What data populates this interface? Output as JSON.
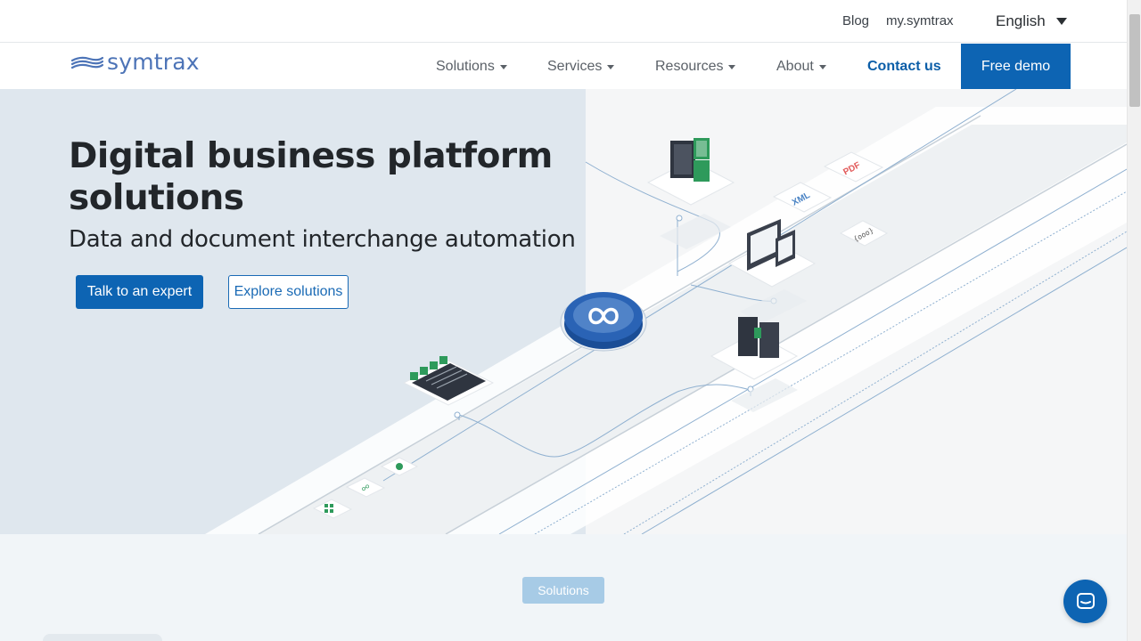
{
  "topbar": {
    "blog": "Blog",
    "my_symtrax": "my.symtrax",
    "language": "English"
  },
  "nav": {
    "logo_text": "symtrax",
    "items": [
      {
        "label": "Solutions"
      },
      {
        "label": "Services"
      },
      {
        "label": "Resources"
      },
      {
        "label": "About"
      }
    ],
    "contact": "Contact us",
    "demo": "Free demo"
  },
  "hero": {
    "title": "Digital business platform solutions",
    "subtitle": "Data and document interchange automation",
    "primary_button": "Talk to an expert",
    "secondary_button": "Explore solutions",
    "illustration_labels": {
      "pdf": "PDF",
      "xml": "XML",
      "code": "{ooo}"
    }
  },
  "section": {
    "solutions_button": "Solutions"
  },
  "colors": {
    "brand_blue": "#0d64b3",
    "logo_blue": "#4d74b7",
    "hero_left_bg": "#dfe7ee",
    "hero_right_bg": "#f5f6f7",
    "accent_green": "#2e9a5b",
    "accent_red": "#e25a5a"
  },
  "icons": {
    "logo": "waves-icon",
    "language": "triangle-down-icon",
    "menu": "caret-down-icon",
    "center_hub": "infinity-icon",
    "chat": "chat-bubble-icon"
  }
}
